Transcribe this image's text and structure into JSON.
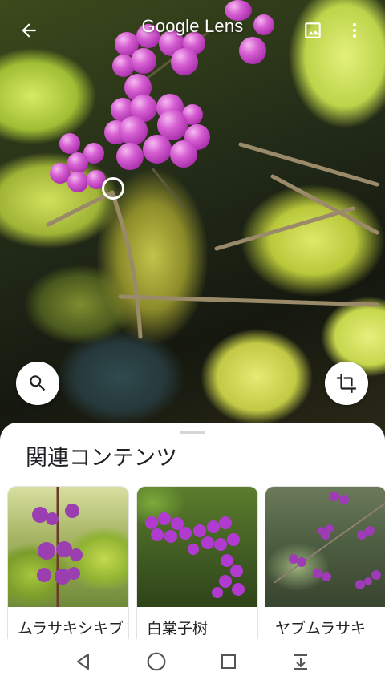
{
  "header": {
    "title": "Google Lens",
    "icons": {
      "back": "arrow-back-icon",
      "gallery": "image-icon",
      "more": "more-vert-icon"
    }
  },
  "actions": {
    "search_icon": "search-icon",
    "crop_icon": "crop-icon"
  },
  "sheet": {
    "title": "関連コンテンツ",
    "cards": [
      {
        "label": "ムラサキシキブ"
      },
      {
        "label": "白棠子树"
      },
      {
        "label": "ヤブムラサキ"
      }
    ]
  },
  "navbar": {
    "icons": [
      "back-triangle-icon",
      "home-circle-icon",
      "recents-square-icon",
      "notification-down-icon"
    ]
  },
  "colors": {
    "berry": "#c04ac4",
    "leaf": "#c8d94f",
    "text": "#202124"
  }
}
